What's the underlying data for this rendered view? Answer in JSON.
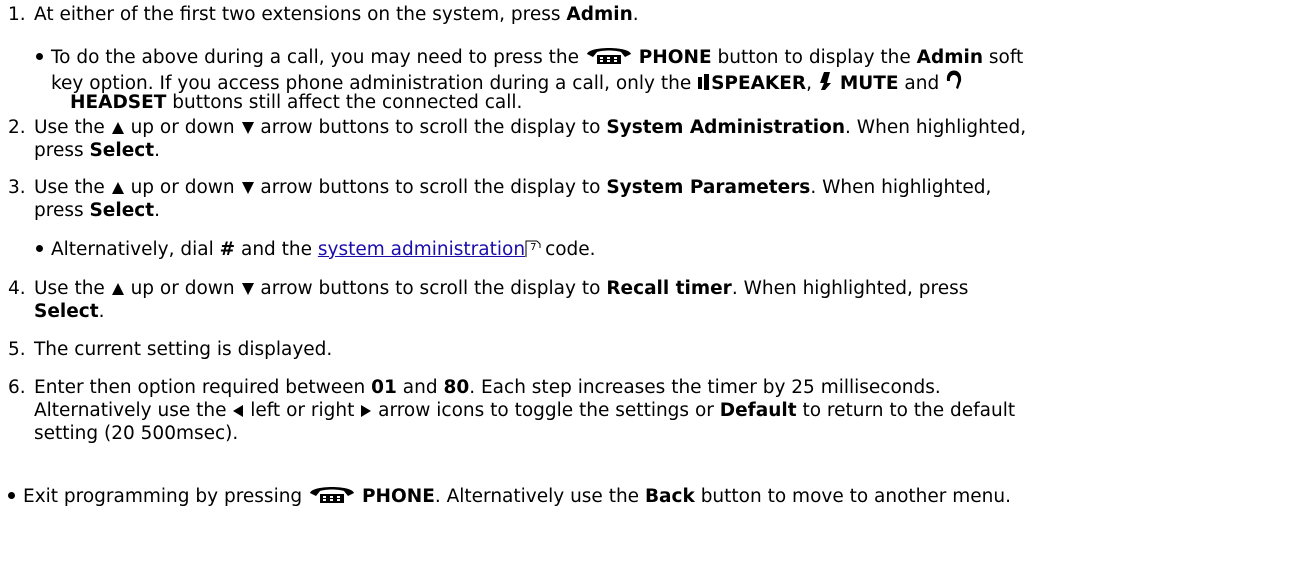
{
  "steps": {
    "s1": {
      "num": "1.",
      "pre": "At either of the first two extensions on the system, press ",
      "b1": "Admin",
      "post": "."
    },
    "note1": {
      "l1_pre": "To do the above during a call, you may need to press the ",
      "l1_b1": "PHONE",
      "l1_mid": " button to display the ",
      "l1_b2": "Admin",
      "l1_post": " soft",
      "l2_pre": "key option. If you access phone administration during a call, only the ",
      "l2_b1": "SPEAKER",
      "l2_c1": ", ",
      "l2_b2": "MUTE",
      "l2_and": " and",
      "l3_b1": "HEADSET",
      "l3_post": " buttons still affect the connected call."
    },
    "s2": {
      "num": "2.",
      "pre": "Use the ",
      "up": " up or down ",
      "mid": " arrow buttons to scroll the display to ",
      "b1": "System Administration",
      "post": ". When highlighted,",
      "l2_pre": "press ",
      "l2_b1": "Select",
      "l2_post": "."
    },
    "s3": {
      "num": "3.",
      "pre": "Use the ",
      "up": " up or down ",
      "mid": " arrow buttons to scroll the display to ",
      "b1": "System Parameters",
      "post": ". When highlighted,",
      "l2_pre": "press ",
      "l2_b1": "Select",
      "l2_post": "."
    },
    "note2": {
      "pre": "Alternatively, dial ",
      "b1": "#",
      "mid": " and the ",
      "link": "system administration",
      "ref": "7",
      "post": "code."
    },
    "s4": {
      "num": "4.",
      "pre": "Use the ",
      "up": " up or down ",
      "mid": " arrow buttons to scroll the display to ",
      "b1": "Recall timer",
      "post": ". When highlighted, press",
      "l2_b1": "Select",
      "l2_post": "."
    },
    "s5": {
      "num": "5.",
      "text": "The current setting is displayed."
    },
    "s6": {
      "num": "6.",
      "pre": "Enter then option required between ",
      "b1": "01",
      "mid": " and ",
      "b2": "80",
      "post": ". Each step increases the timer by 25 milliseconds.",
      "l2_pre": "Alternatively use the ",
      "l2_left": " left or right ",
      "l2_mid": " arrow icons to toggle the settings or ",
      "l2_b1": "Default",
      "l2_post": " to return to the default",
      "l3": "setting (20 500msec)."
    },
    "exit": {
      "pre": "Exit programming by pressing ",
      "b1": "PHONE",
      "mid": ". Alternatively use the ",
      "b2": "Back",
      "post": " button to move to another menu."
    }
  },
  "icons": [
    "phone-icon",
    "speaker-icon",
    "mute-icon",
    "headset-icon",
    "arrow-up-icon",
    "arrow-down-icon",
    "arrow-left-icon",
    "arrow-right-icon",
    "cross-reference-icon"
  ],
  "colors": {
    "link": "#1a0dab",
    "text": "#000000"
  }
}
